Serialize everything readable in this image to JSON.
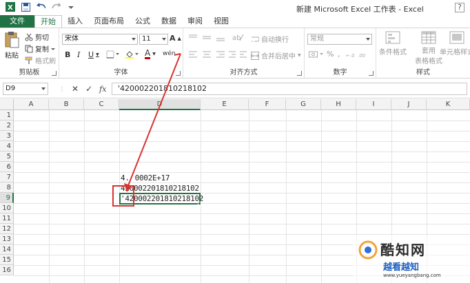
{
  "window": {
    "title": "新建 Microsoft Excel 工作表 - Excel",
    "help": "?"
  },
  "tabs": [
    {
      "label": "文件"
    },
    {
      "label": "开始"
    },
    {
      "label": "插入"
    },
    {
      "label": "页面布局"
    },
    {
      "label": "公式"
    },
    {
      "label": "数据"
    },
    {
      "label": "审阅"
    },
    {
      "label": "视图"
    }
  ],
  "ribbon": {
    "clipboard": {
      "group": "剪贴板",
      "paste": "粘贴",
      "cut": "剪切",
      "copy": "复制",
      "format_painter": "格式刷"
    },
    "font": {
      "group": "字体",
      "font_name": "宋体",
      "font_size": "11",
      "bold": "B",
      "italic": "I",
      "underline": "U",
      "grow": "A",
      "shrink": "A",
      "font_color": "A",
      "wen": "wén"
    },
    "alignment": {
      "group": "对齐方式",
      "wrap": "自动换行",
      "merge": "合并后居中"
    },
    "number": {
      "group": "数字",
      "format": "常规",
      "percent": "%",
      "comma": ","
    },
    "styles": {
      "group": "样式",
      "conditional": "条件格式",
      "table_line1": "套用",
      "table_line2": "表格格式",
      "cell_styles": "单元格样式"
    }
  },
  "formula_bar": {
    "name_box": "D9",
    "cancel": "✕",
    "enter": "✓",
    "fx": "fx",
    "content": "'420002201810218102"
  },
  "grid": {
    "columns": [
      "A",
      "B",
      "C",
      "D",
      "E",
      "F",
      "G",
      "H",
      "I",
      "J",
      "K"
    ],
    "rows": [
      "1",
      "2",
      "3",
      "4",
      "5",
      "6",
      "7",
      "8",
      "9",
      "10",
      "11",
      "12",
      "13",
      "14",
      "15",
      "16"
    ],
    "cells": {
      "D7": "4.2E+17",
      "D7_display_a": "4.",
      "D7_display_b": "0002E+17",
      "D8": "420002201810218102",
      "D9": "'420002201810218102"
    }
  },
  "watermark": {
    "brand": "酷知网",
    "sub": "www.yueyangbang.com",
    "alt": "越看越知"
  },
  "colors": {
    "excel_green": "#217346",
    "annotation_red": "#d9322f"
  }
}
